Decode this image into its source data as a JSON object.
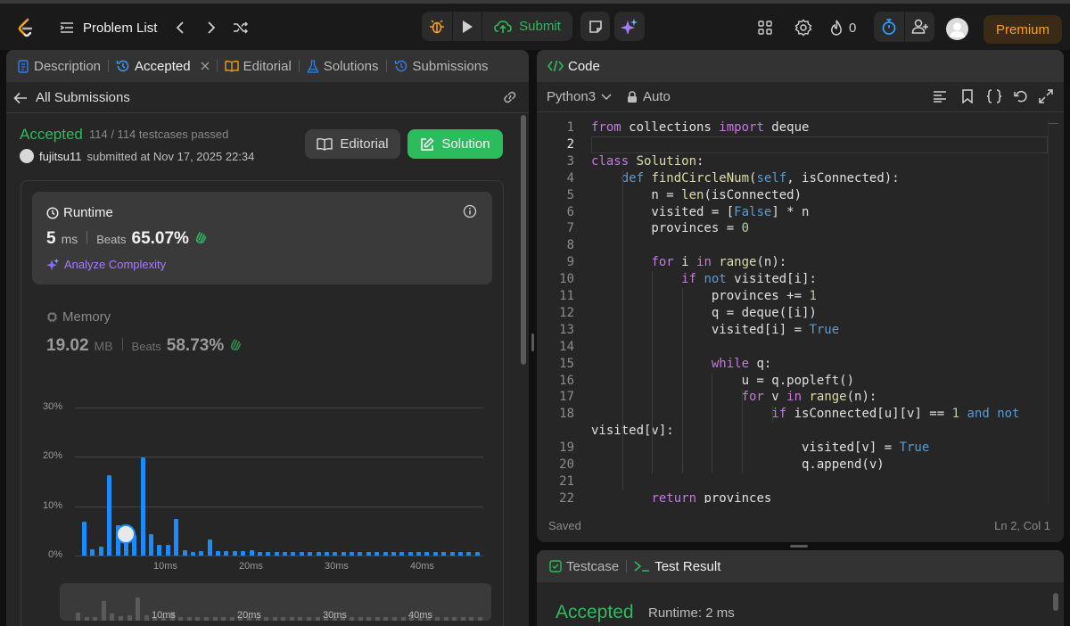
{
  "header": {
    "problem_list_label": "Problem List",
    "submit_label": "Submit",
    "streak_count": "0",
    "premium_label": "Premium"
  },
  "left_tabs": {
    "description": "Description",
    "accepted": "Accepted",
    "editorial": "Editorial",
    "solutions": "Solutions",
    "submissions": "Submissions"
  },
  "submission": {
    "back_label": "All Submissions",
    "status": "Accepted",
    "testcases": "114 / 114 testcases passed",
    "user": "fujitsu11",
    "submitted_at": "submitted at Nov 17, 2025 22:34",
    "editorial_btn": "Editorial",
    "solution_btn": "Solution",
    "runtime": {
      "title": "Runtime",
      "value": "5",
      "unit": "ms",
      "beats_label": "Beats",
      "beats_value": "65.07%",
      "analyze_label": "Analyze Complexity"
    },
    "memory": {
      "title": "Memory",
      "value": "19.02",
      "unit": "MB",
      "beats_label": "Beats",
      "beats_value": "58.73%"
    }
  },
  "chart_data": {
    "type": "bar",
    "ylim": [
      0,
      30
    ],
    "yticks": [
      "30%",
      "20%",
      "10%",
      "0%"
    ],
    "xticks": [
      "10ms",
      "20ms",
      "30ms",
      "40ms"
    ],
    "values": [
      6.8,
      1.2,
      1.8,
      16.2,
      6.2,
      4.1,
      4.2,
      19.8,
      4.3,
      2.1,
      2.1,
      7.4,
      1.0,
      0.8,
      0.9,
      3.2,
      0.9,
      0.9,
      0.9,
      0.9,
      1.1,
      0.8,
      0.8,
      0.8,
      0.8,
      0.8,
      0.8,
      0.8,
      0.8,
      0.8,
      0.8,
      0.8,
      0.8,
      0.8,
      0.8,
      0.8,
      0.8,
      0.8,
      0.8,
      0.8,
      0.8,
      0.8,
      0.8,
      0.8,
      0.8,
      0.8,
      0.8,
      0.8
    ],
    "highlight_index": 5,
    "accent_color": "#1a8cff"
  },
  "code_panel": {
    "title": "Code",
    "language": "Python3",
    "mode": "Auto",
    "status": "Saved",
    "cursor": "Ln 2, Col 1",
    "lines": [
      [
        [
          "kw",
          "from"
        ],
        [
          "pl",
          " collections "
        ],
        [
          "kw",
          "import"
        ],
        [
          "pl",
          " deque"
        ]
      ],
      [],
      [
        [
          "kw",
          "class"
        ],
        [
          "pl",
          " "
        ],
        [
          "fn",
          "Solution"
        ],
        [
          "pl",
          ":"
        ]
      ],
      [
        [
          "pl",
          "    "
        ],
        [
          "bl",
          "def"
        ],
        [
          "pl",
          " "
        ],
        [
          "fn",
          "findCircleNum"
        ],
        [
          "pl",
          "("
        ],
        [
          "bl",
          "self"
        ],
        [
          "pl",
          ", isConnected):"
        ]
      ],
      [
        [
          "pl",
          "        n = "
        ],
        [
          "fn",
          "len"
        ],
        [
          "pl",
          "(isConnected)"
        ]
      ],
      [
        [
          "pl",
          "        visited = ["
        ],
        [
          "bl",
          "False"
        ],
        [
          "pl",
          "] * n"
        ]
      ],
      [
        [
          "pl",
          "        provinces = "
        ],
        [
          "nm",
          "0"
        ]
      ],
      [],
      [
        [
          "pl",
          "        "
        ],
        [
          "kw",
          "for"
        ],
        [
          "pl",
          " i "
        ],
        [
          "kw",
          "in"
        ],
        [
          "pl",
          " "
        ],
        [
          "fn",
          "range"
        ],
        [
          "pl",
          "(n):"
        ]
      ],
      [
        [
          "pl",
          "            "
        ],
        [
          "kw",
          "if"
        ],
        [
          "pl",
          " "
        ],
        [
          "bl",
          "not"
        ],
        [
          "pl",
          " visited[i]:"
        ]
      ],
      [
        [
          "pl",
          "                provinces += "
        ],
        [
          "nm",
          "1"
        ]
      ],
      [
        [
          "pl",
          "                q = deque([i])"
        ]
      ],
      [
        [
          "pl",
          "                visited[i] = "
        ],
        [
          "bl",
          "True"
        ]
      ],
      [],
      [
        [
          "pl",
          "                "
        ],
        [
          "kw",
          "while"
        ],
        [
          "pl",
          " q:"
        ]
      ],
      [
        [
          "pl",
          "                    u = q.popleft()"
        ]
      ],
      [
        [
          "pl",
          "                    "
        ],
        [
          "kw",
          "for"
        ],
        [
          "pl",
          " v "
        ],
        [
          "kw",
          "in"
        ],
        [
          "pl",
          " "
        ],
        [
          "fn",
          "range"
        ],
        [
          "pl",
          "(n):"
        ]
      ],
      [
        [
          "pl",
          "                        "
        ],
        [
          "kw",
          "if"
        ],
        [
          "pl",
          " isConnected[u][v] == "
        ],
        [
          "nm",
          "1"
        ],
        [
          "pl",
          " "
        ],
        [
          "bl",
          "and"
        ],
        [
          "pl",
          " "
        ],
        [
          "bl",
          "not"
        ]
      ],
      [
        [
          "pl",
          "visited[v]:"
        ]
      ],
      [
        [
          "pl",
          "                            visited[v] = "
        ],
        [
          "bl",
          "True"
        ]
      ],
      [
        [
          "pl",
          "                            q.append(v)"
        ]
      ],
      [],
      [
        [
          "pl",
          "        "
        ],
        [
          "kw",
          "return"
        ],
        [
          "pl",
          " provinces"
        ]
      ]
    ],
    "line_numbers": [
      "1",
      "2",
      "3",
      "4",
      "5",
      "6",
      "7",
      "8",
      "9",
      "10",
      "11",
      "12",
      "13",
      "14",
      "15",
      "16",
      "17",
      "18",
      "",
      "19",
      "20",
      "21",
      "22"
    ]
  },
  "bottom_panel": {
    "testcase_tab": "Testcase",
    "test_result_tab": "Test Result",
    "status": "Accepted",
    "runtime": "Runtime: 2 ms"
  }
}
